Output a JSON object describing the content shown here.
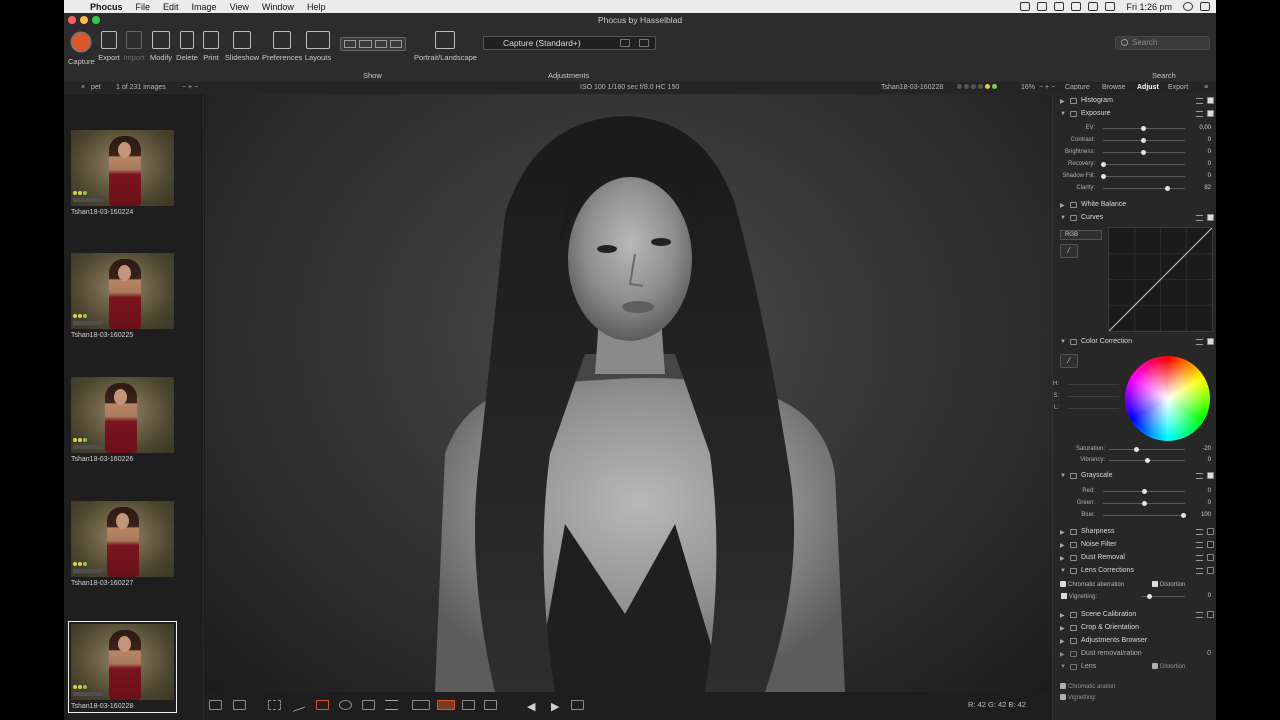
{
  "menubar": {
    "app_name": "Phocus",
    "items": [
      "File",
      "Edit",
      "Image",
      "View",
      "Window",
      "Help"
    ],
    "clock": "Fri 1:26 pm"
  },
  "window": {
    "title": "Phocus by Hasselblad"
  },
  "toolbar": {
    "tools": [
      {
        "label": "Capture",
        "icon": "capture-icon"
      },
      {
        "label": "Export",
        "icon": "export-icon"
      },
      {
        "label": "Import",
        "icon": "import-icon"
      },
      {
        "label": "Modify",
        "icon": "modify-icon"
      },
      {
        "label": "Delete",
        "icon": "delete-icon"
      },
      {
        "label": "Print",
        "icon": "print-icon"
      },
      {
        "label": "Slideshow",
        "icon": "slideshow-icon"
      },
      {
        "label": "Preferences",
        "icon": "preferences-icon"
      },
      {
        "label": "Layouts",
        "icon": "layouts-icon"
      }
    ],
    "show_label": "Show",
    "portrait_landscape_label": "Portrait/Landscape",
    "preset_value": "Capture (Standard+)",
    "adjustments_label": "Adjustments",
    "search_placeholder": "Search",
    "search_label": "Search"
  },
  "infostrip": {
    "filter": "pet",
    "count": "1 of 231 images",
    "exif": "ISO 100   1/160 sec   f/8.0   HC 150",
    "filename": "Tshan18-03-160228",
    "zoom": "16%",
    "tabs": [
      "Capture",
      "Browse",
      "Adjust",
      "Export"
    ],
    "active_tab": "Adjust"
  },
  "browser": {
    "thumbnails": [
      {
        "label": "Tshan18-03-160224"
      },
      {
        "label": "Tshan18-03-160225"
      },
      {
        "label": "Tshan18-03-160226"
      },
      {
        "label": "Tshan18-03-160227"
      },
      {
        "label": "Tshan18-03-160228"
      }
    ]
  },
  "panel": {
    "histogram": "Histogram",
    "exposure": {
      "title": "Exposure",
      "rows": [
        {
          "label": "EV:",
          "value": "0,00"
        },
        {
          "label": "Contrast:",
          "value": "0"
        },
        {
          "label": "Brightness:",
          "value": "0"
        },
        {
          "label": "Recovery:",
          "value": "0"
        },
        {
          "label": "Shadow Fill:",
          "value": "0"
        },
        {
          "label": "Clarity:",
          "value": "82"
        }
      ]
    },
    "white_balance": "White Balance",
    "curves": {
      "title": "Curves",
      "channel": "RGB"
    },
    "color_correction": {
      "title": "Color Correction",
      "hsl": [
        "H:",
        "S:",
        "L:"
      ],
      "rows": [
        {
          "label": "Saturation:",
          "value": "-20"
        },
        {
          "label": "Vibrancy:",
          "value": "0"
        }
      ]
    },
    "grayscale": {
      "title": "Grayscale",
      "rows": [
        {
          "label": "Red:",
          "value": "0"
        },
        {
          "label": "Green:",
          "value": "0"
        },
        {
          "label": "Blue:",
          "value": "100"
        }
      ]
    },
    "sharpness": "Sharpness",
    "noise_filter": "Noise Filter",
    "dust_removal": "Dust Removal",
    "lens_corrections": {
      "title": "Lens Corrections",
      "chromatic": "Chromatic aberration",
      "distortion": "Distortion",
      "vignetting_label": "Vignetting:",
      "vignetting_value": "0"
    },
    "scene_calibration": "Scene Calibration",
    "crop_orientation": "Crop & Orientation",
    "adjustments_browser": "Adjustments Browser",
    "ghost_dust": "Dust removal/ration",
    "ghost_lens": "Lens",
    "ghost_distortion": "Distortion",
    "ghost_chromatic": "Chromatic aration",
    "ghost_vignetting": "Vignetting:",
    "ghost_value": "0"
  },
  "viewer": {
    "readout_left": "R: 42  G: 42  B: 42",
    "readout_right": "R:"
  }
}
